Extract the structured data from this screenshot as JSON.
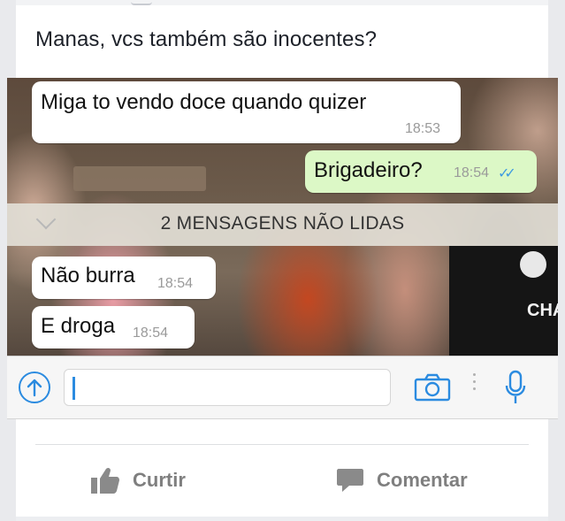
{
  "post": {
    "text": "Manas, vcs também são inocentes?"
  },
  "chat": {
    "messages": [
      {
        "direction": "in",
        "text": "Miga to vendo doce quando quizer",
        "time": "18:53"
      },
      {
        "direction": "out",
        "text": "Brigadeiro?",
        "time": "18:54"
      },
      {
        "direction": "in",
        "text": "Não burra",
        "time": "18:54"
      },
      {
        "direction": "in",
        "text": "E droga",
        "time": "18:54"
      }
    ],
    "unread_label": "2 MENSAGENS NÃO LIDAS",
    "read_receipt": "double-check-icon",
    "wallpaper_text": "CHA"
  },
  "actions": {
    "like_label": "Curtir",
    "comment_label": "Comentar"
  },
  "colors": {
    "outgoing_bubble": "#dcf8c6",
    "accent_blue": "#2b8be0",
    "action_gray": "#7f7f7f"
  }
}
